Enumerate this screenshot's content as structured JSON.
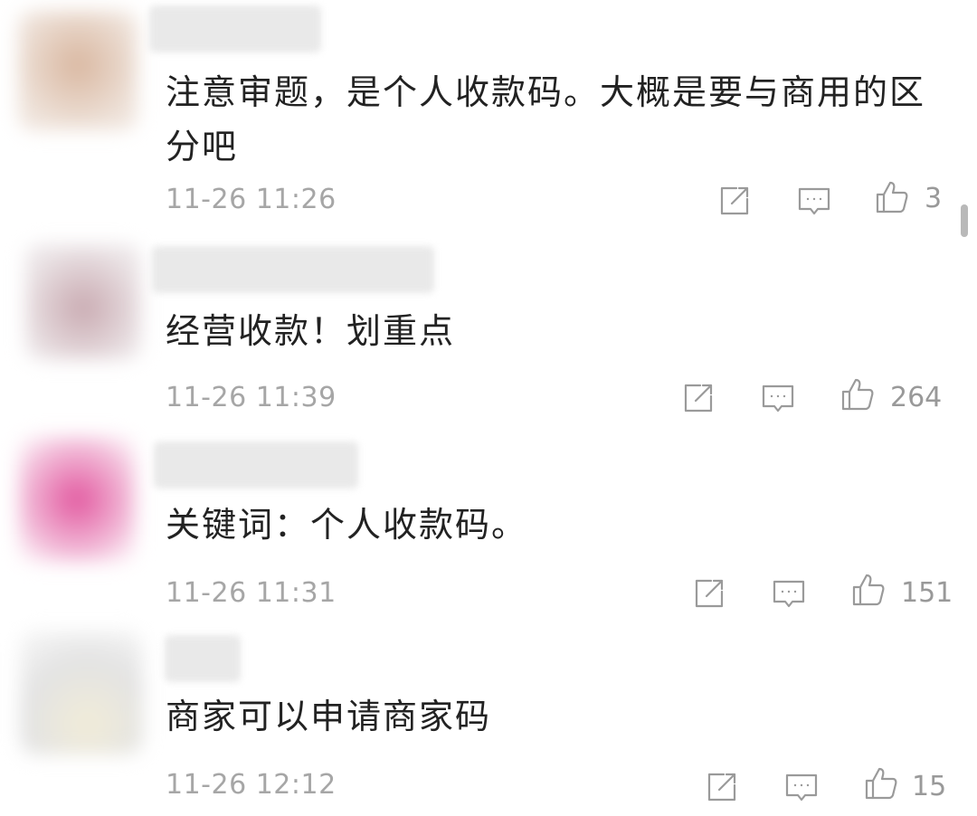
{
  "comments": [
    {
      "text": "注意审题，是个人收款码。大概是要与商用的区分吧",
      "time": "11-26 11:26",
      "likes": "3",
      "avatar_color": "#d9b7a0"
    },
    {
      "text": "经营收款！划重点",
      "time": "11-26 11:39",
      "likes": "264",
      "avatar_color": "#c9aab1"
    },
    {
      "text": "关键词：个人收款码。",
      "time": "11-26 11:31",
      "likes": "151",
      "avatar_color": "#e2589f"
    },
    {
      "text": "商家可以申请商家码",
      "time": "11-26 12:12",
      "likes": "15",
      "avatar_color": "#dcdcdc"
    }
  ],
  "icons": {
    "share": "share-icon",
    "reply": "reply-icon",
    "like": "thumbs-up-icon"
  }
}
